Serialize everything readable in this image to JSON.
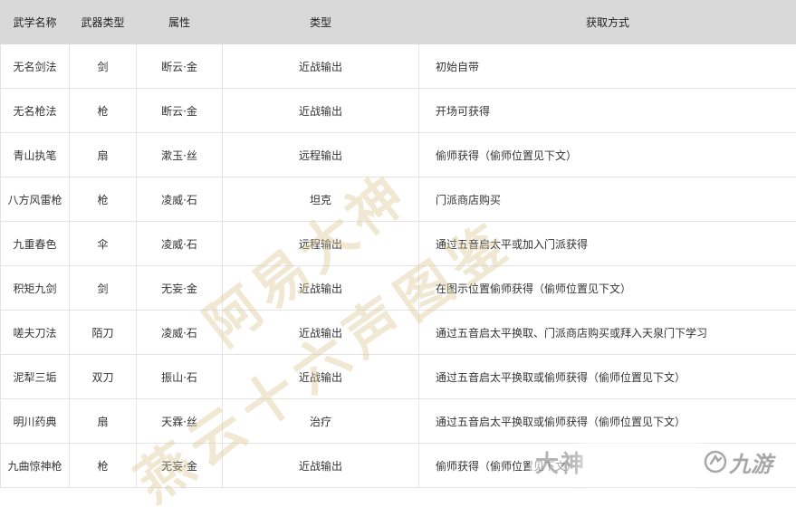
{
  "table": {
    "columns": [
      "武学名称",
      "武器类型",
      "属性",
      "类型",
      "获取方式"
    ],
    "rows": [
      [
        "无名剑法",
        "剑",
        "断云·金",
        "近战输出",
        "初始自带"
      ],
      [
        "无名枪法",
        "枪",
        "断云·金",
        "近战输出",
        "开场可获得"
      ],
      [
        "青山执笔",
        "扇",
        "漱玉·丝",
        "远程输出",
        "偷师获得（偷师位置见下文）"
      ],
      [
        "八方风雷枪",
        "枪",
        "凌威·石",
        "坦克",
        "门派商店购买"
      ],
      [
        "九重春色",
        "伞",
        "凌威·石",
        "远程输出",
        "通过五音启太平或加入门派获得"
      ],
      [
        "积矩九剑",
        "剑",
        "无妄·金",
        "近战输出",
        "在图示位置偷师获得（偷师位置见下文）"
      ],
      [
        "嗟夫刀法",
        "陌刀",
        "凌威·石",
        "近战输出",
        "通过五音启太平换取、门派商店购买或拜入天泉门下学习"
      ],
      [
        "泥犁三垢",
        "双刀",
        "振山·石",
        "近战输出",
        "通过五音启太平换取或偷师获得（偷师位置见下文）"
      ],
      [
        "明川药典",
        "扇",
        "天霖·丝",
        "治疗",
        "通过五音启太平换取或偷师获得（偷师位置见下文）"
      ],
      [
        "九曲惊神枪",
        "枪",
        "无妄·金",
        "近战输出",
        "偷师获得（偷师位置见下文）"
      ]
    ]
  },
  "watermark": {
    "line1": "阿易大神",
    "line2": "燕云十六声图鉴",
    "logo_left": "大神",
    "logo_right": "九游"
  }
}
